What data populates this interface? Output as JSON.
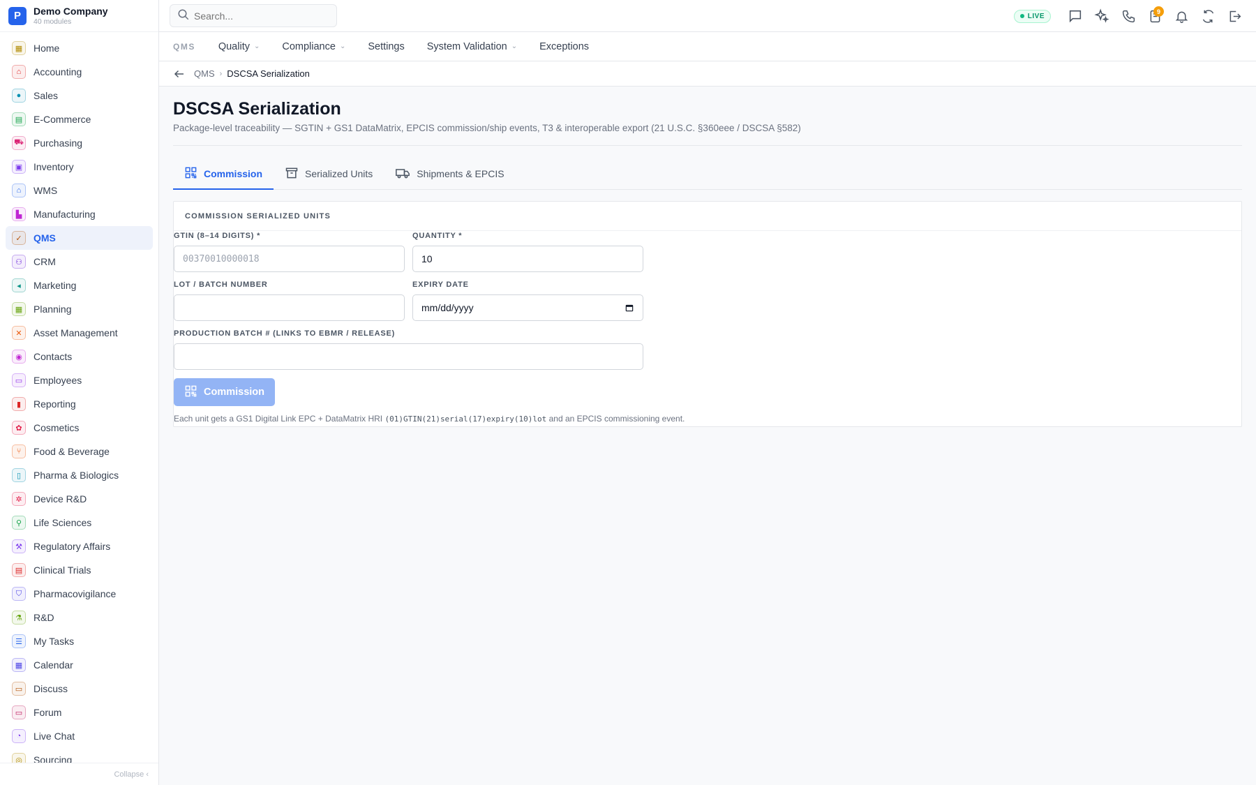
{
  "brand": {
    "logo_letter": "P",
    "name": "Demo Company",
    "subtitle": "40 modules",
    "color": "#2563eb"
  },
  "sidebar": {
    "items": [
      {
        "label": "Home",
        "icon": "grid-icon",
        "color": "#b08a00"
      },
      {
        "label": "Accounting",
        "icon": "bank-icon",
        "color": "#dc2626"
      },
      {
        "label": "Sales",
        "icon": "user-icon",
        "color": "#0891b2"
      },
      {
        "label": "E-Commerce",
        "icon": "store-icon",
        "color": "#16a34a"
      },
      {
        "label": "Purchasing",
        "icon": "cart-icon",
        "color": "#db2777"
      },
      {
        "label": "Inventory",
        "icon": "box-icon",
        "color": "#7c3aed"
      },
      {
        "label": "WMS",
        "icon": "warehouse-icon",
        "color": "#2563eb"
      },
      {
        "label": "Manufacturing",
        "icon": "factory-icon",
        "color": "#c026d3"
      },
      {
        "label": "QMS",
        "icon": "check-badge-icon",
        "color": "#b45309",
        "active": true
      },
      {
        "label": "CRM",
        "icon": "users-icon",
        "color": "#6d28d9"
      },
      {
        "label": "Marketing",
        "icon": "megaphone-icon",
        "color": "#0d9488"
      },
      {
        "label": "Planning",
        "icon": "calendar-icon",
        "color": "#65a30d"
      },
      {
        "label": "Asset Management",
        "icon": "tools-icon",
        "color": "#ea580c"
      },
      {
        "label": "Contacts",
        "icon": "contact-icon",
        "color": "#c026d3"
      },
      {
        "label": "Employees",
        "icon": "briefcase-icon",
        "color": "#9333ea"
      },
      {
        "label": "Reporting",
        "icon": "bar-chart-icon",
        "color": "#dc2626"
      },
      {
        "label": "Cosmetics",
        "icon": "flower-icon",
        "color": "#e11d48"
      },
      {
        "label": "Food & Beverage",
        "icon": "utensils-icon",
        "color": "#ea580c"
      },
      {
        "label": "Pharma & Biologics",
        "icon": "pill-icon",
        "color": "#0891b2"
      },
      {
        "label": "Device R&D",
        "icon": "cog-icon",
        "color": "#e11d48"
      },
      {
        "label": "Life Sciences",
        "icon": "microscope-icon",
        "color": "#16a34a"
      },
      {
        "label": "Regulatory Affairs",
        "icon": "gavel-icon",
        "color": "#7c3aed"
      },
      {
        "label": "Clinical Trials",
        "icon": "clipboard-icon",
        "color": "#dc2626"
      },
      {
        "label": "Pharmacovigilance",
        "icon": "shield-icon",
        "color": "#4f46e5"
      },
      {
        "label": "R&D",
        "icon": "flask-icon",
        "color": "#65a30d"
      },
      {
        "label": "My Tasks",
        "icon": "checklist-icon",
        "color": "#2563eb"
      },
      {
        "label": "Calendar",
        "icon": "calendar-icon",
        "color": "#4f46e5"
      },
      {
        "label": "Discuss",
        "icon": "chat-icon",
        "color": "#b45309"
      },
      {
        "label": "Forum",
        "icon": "forum-icon",
        "color": "#be185d"
      },
      {
        "label": "Live Chat",
        "icon": "headset-icon",
        "color": "#7c3aed"
      },
      {
        "label": "Sourcing",
        "icon": "search-icon",
        "color": "#b08a00"
      }
    ],
    "collapse_label": "Collapse ‹"
  },
  "topbar": {
    "search_placeholder": "Search...",
    "live_label": "LIVE",
    "notification_count": "9"
  },
  "modnav": {
    "label": "QMS",
    "items": [
      {
        "label": "Quality",
        "dropdown": true
      },
      {
        "label": "Compliance",
        "dropdown": true
      },
      {
        "label": "Settings",
        "dropdown": false
      },
      {
        "label": "System Validation",
        "dropdown": true
      },
      {
        "label": "Exceptions",
        "dropdown": false
      }
    ]
  },
  "breadcrumb": {
    "parent": "QMS",
    "current": "DSCSA Serialization"
  },
  "page": {
    "title": "DSCSA Serialization",
    "subtitle": "Package-level traceability — SGTIN + GS1 DataMatrix, EPCIS commission/ship events, T3 & interoperable export (21 U.S.C. §360eee / DSCSA §582)"
  },
  "tabs": [
    {
      "label": "Commission",
      "icon": "qr-code-icon",
      "active": true
    },
    {
      "label": "Serialized Units",
      "icon": "archive-icon",
      "active": false
    },
    {
      "label": "Shipments & EPCIS",
      "icon": "truck-icon",
      "active": false
    }
  ],
  "form": {
    "section_title": "COMMISSION SERIALIZED UNITS",
    "gtin_label": "GTIN (8–14 DIGITS) *",
    "gtin_placeholder": "00370010000018",
    "gtin_value": "",
    "quantity_label": "QUANTITY *",
    "quantity_value": "10",
    "lot_label": "LOT / BATCH NUMBER",
    "lot_value": "",
    "expiry_label": "EXPIRY DATE",
    "expiry_placeholder": "mm/dd/yyyy",
    "production_label": "PRODUCTION BATCH # (LINKS TO EBMR / RELEASE)",
    "production_value": "",
    "submit_label": "Commission",
    "help_prefix": "Each unit gets a GS1 Digital Link EPC + DataMatrix HRI ",
    "help_code": "(01)GTIN(21)serial(17)expiry(10)lot",
    "help_suffix": " and an EPCIS commissioning event."
  }
}
